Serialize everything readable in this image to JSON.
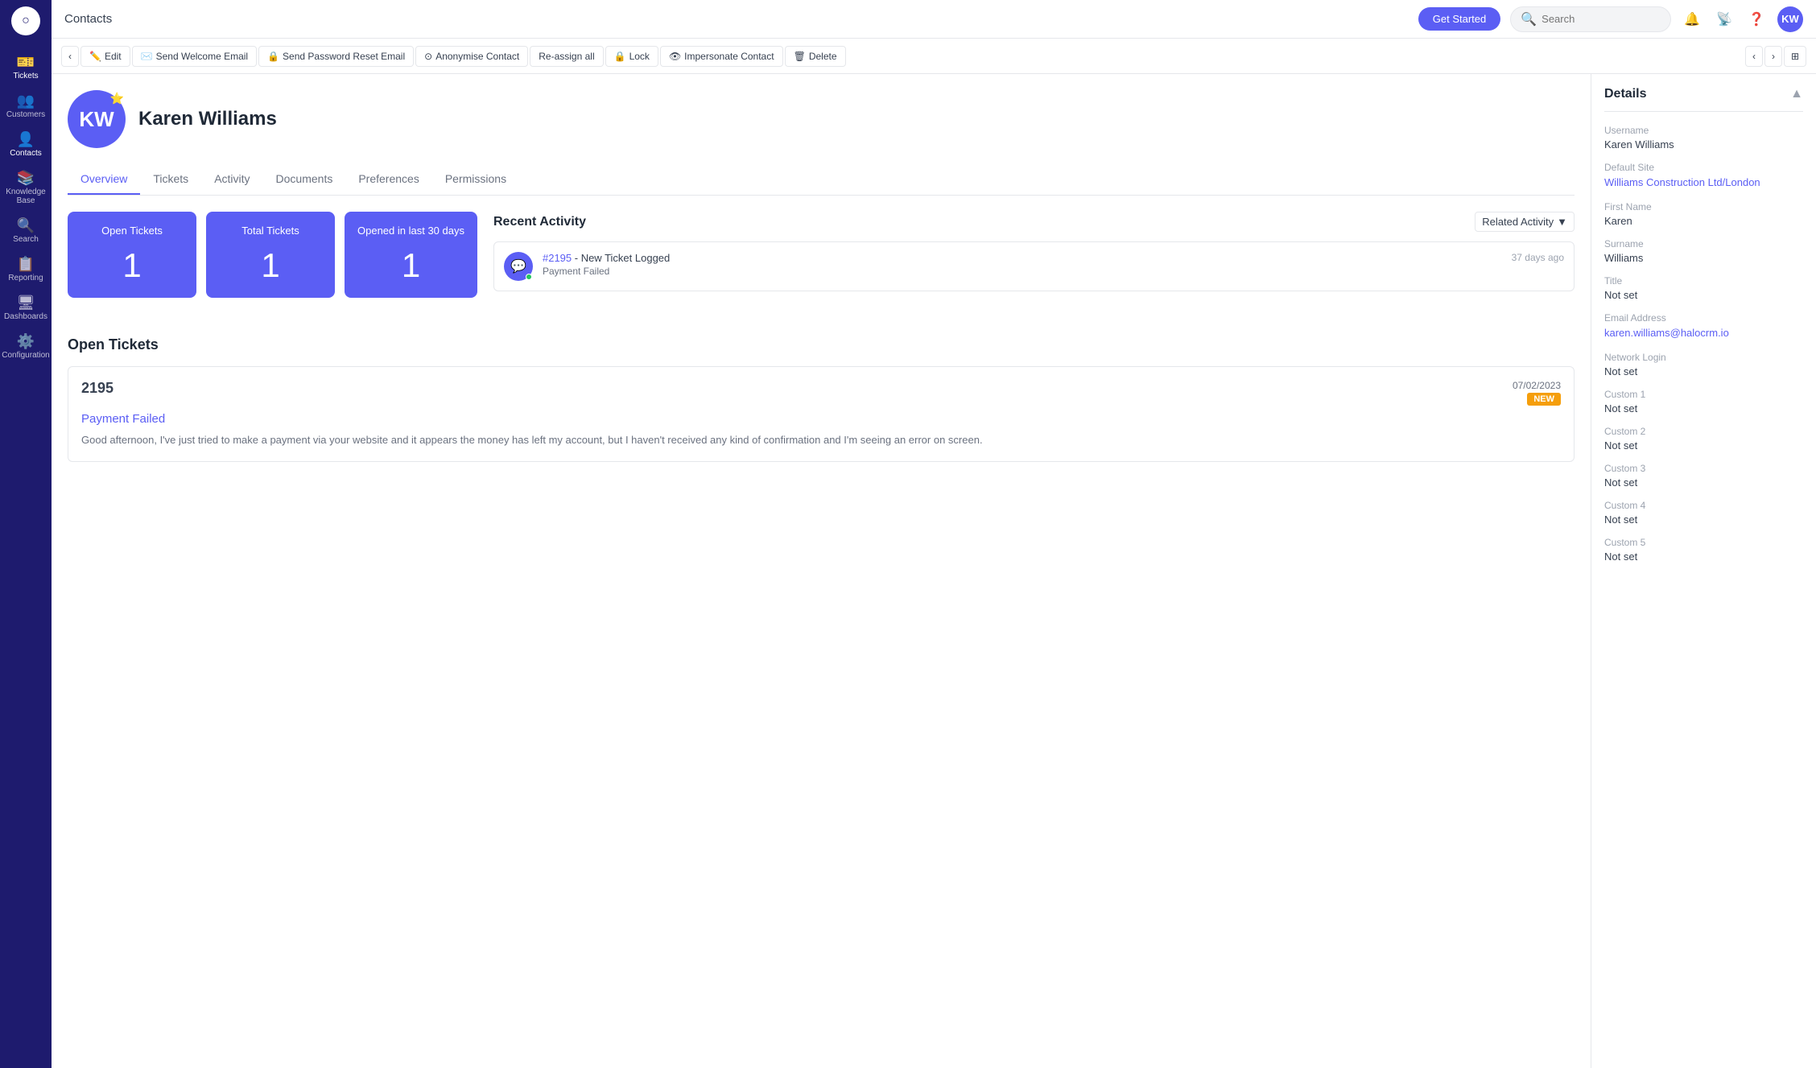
{
  "app": {
    "logo": "○"
  },
  "sidebar": {
    "items": [
      {
        "id": "tickets",
        "label": "Tickets",
        "icon": "🎫"
      },
      {
        "id": "customers",
        "label": "Customers",
        "icon": "👥"
      },
      {
        "id": "contacts",
        "label": "Contacts",
        "icon": "👤"
      },
      {
        "id": "knowledge-base",
        "label": "Knowledge Base",
        "icon": "📚"
      },
      {
        "id": "search",
        "label": "Search",
        "icon": "🔍"
      },
      {
        "id": "reporting",
        "label": "Reporting",
        "icon": "📋"
      },
      {
        "id": "dashboards",
        "label": "Dashboards",
        "icon": "🖥"
      },
      {
        "id": "configuration",
        "label": "Configuration",
        "icon": "⚙️"
      }
    ]
  },
  "header": {
    "breadcrumb": "Contacts",
    "get_started": "Get Started",
    "search_placeholder": "Search",
    "avatar_initials": "KW"
  },
  "toolbar": {
    "back_label": "‹",
    "forward_label": "›",
    "edit_label": "Edit",
    "send_welcome_label": "Send Welcome Email",
    "send_reset_label": "Send Password Reset Email",
    "anonymise_label": "Anonymise Contact",
    "reassign_label": "Re-assign all",
    "lock_label": "Lock",
    "impersonate_label": "Impersonate Contact",
    "delete_label": "Delete",
    "external_icon": "⊞"
  },
  "profile": {
    "initials": "KW",
    "name": "Karen Williams",
    "badge": "⭐"
  },
  "tabs": [
    {
      "id": "overview",
      "label": "Overview",
      "active": true
    },
    {
      "id": "tickets",
      "label": "Tickets"
    },
    {
      "id": "activity",
      "label": "Activity"
    },
    {
      "id": "documents",
      "label": "Documents"
    },
    {
      "id": "preferences",
      "label": "Preferences"
    },
    {
      "id": "permissions",
      "label": "Permissions"
    }
  ],
  "stats": [
    {
      "id": "open-tickets",
      "label": "Open Tickets",
      "value": "1"
    },
    {
      "id": "total-tickets",
      "label": "Total Tickets",
      "value": "1"
    },
    {
      "id": "opened-last-30",
      "label": "Opened in last 30 days",
      "value": "1"
    }
  ],
  "activity": {
    "title": "Recent Activity",
    "filter_label": "Related Activity",
    "items": [
      {
        "id": "act1",
        "ticket_ref": "#2195",
        "ticket_action": " - New Ticket Logged",
        "time": "37 days ago",
        "subject": "Payment Failed"
      }
    ]
  },
  "open_tickets": {
    "section_title": "Open Tickets",
    "items": [
      {
        "id_num": "2195",
        "subject": "Payment Failed",
        "date": "07/02/2023",
        "badge": "NEW",
        "body": "Good afternoon,\nI've just tried to make a payment via your website and it appears the money has left my account, but I haven't received any kind of confirmation and I'm seeing an error on screen."
      }
    ]
  },
  "details": {
    "panel_title": "Details",
    "fields": [
      {
        "label": "Username",
        "value": "Karen Williams",
        "type": "text"
      },
      {
        "label": "Default Site",
        "value": "Williams Construction Ltd/London",
        "type": "link"
      },
      {
        "label": "First Name",
        "value": "Karen",
        "type": "text"
      },
      {
        "label": "Surname",
        "value": "Williams",
        "type": "text"
      },
      {
        "label": "Title",
        "value": "Not set",
        "type": "text"
      },
      {
        "label": "Email Address",
        "value": "karen.williams@halocrm.io",
        "type": "link"
      },
      {
        "label": "Network Login",
        "value": "Not set",
        "type": "text"
      },
      {
        "label": "Custom 1",
        "value": "Not set",
        "type": "text"
      },
      {
        "label": "Custom 2",
        "value": "Not set",
        "type": "text"
      },
      {
        "label": "Custom 3",
        "value": "Not set",
        "type": "text"
      },
      {
        "label": "Custom 4",
        "value": "Not set",
        "type": "text"
      },
      {
        "label": "Custom 5",
        "value": "Not set",
        "type": "text"
      }
    ]
  }
}
